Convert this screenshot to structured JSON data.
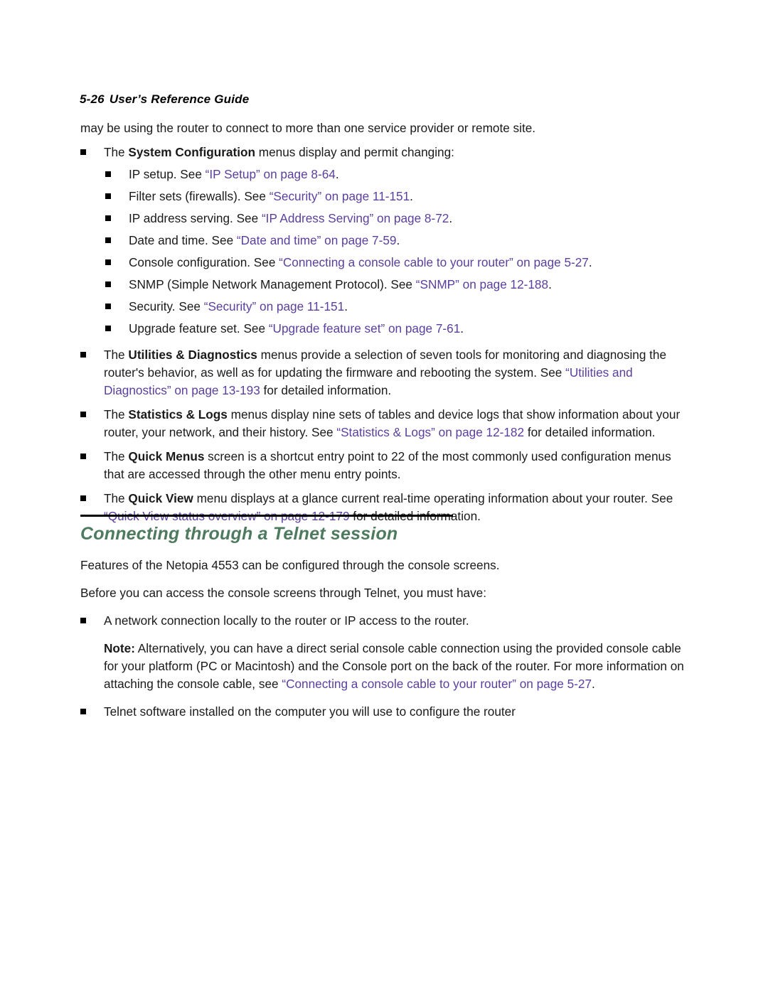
{
  "page": {
    "header": {
      "folio": "5-26",
      "title": "User’s Reference Guide"
    },
    "intro_paragraph": "may be using the router to connect to more than one service provider or remote site.",
    "bullets": [
      {
        "name": "system-configuration",
        "lead": "The ",
        "bold": "System Configuration",
        "tail": " menus display and permit changing:",
        "subitems": [
          {
            "name": "ip-setup",
            "lead": "IP setup. See ",
            "xref": "“IP Setup” on page 8-64",
            "tail": "."
          },
          {
            "name": "filter-sets",
            "lead": "Filter sets (firewalls). See ",
            "xref": "“Security” on page 11-151",
            "tail": "."
          },
          {
            "name": "ip-address-serving",
            "lead": "IP address serving. See ",
            "xref": "“IP Address Serving” on page 8-72",
            "tail": "."
          },
          {
            "name": "date-and-time",
            "lead": "Date and time. See ",
            "xref": "“Date and time” on page 7-59",
            "tail": "."
          },
          {
            "name": "console-configuration",
            "lead": "Console configuration. See ",
            "xref": "“Connecting a console cable to your router” on page 5-27",
            "tail": "."
          },
          {
            "name": "snmp",
            "lead": "SNMP (Simple Network Management Protocol). See ",
            "xref": "“SNMP” on page 12-188",
            "tail": "."
          },
          {
            "name": "security",
            "lead": "Security. See ",
            "xref": "“Security” on page 11-151",
            "tail": "."
          },
          {
            "name": "upgrade-feature-set",
            "lead": "Upgrade feature set. See ",
            "xref": "“Upgrade feature set” on page 7-61",
            "tail": "."
          }
        ]
      }
    ],
    "utilities_bullet": {
      "lead": "The ",
      "bold": "Utilities & Diagnostics",
      "mid": " menus provide a selection of seven tools for monitoring and diagnosing the router's behavior, as well as for updating the firmware and rebooting the system. See ",
      "xref": "“Utilities and Diagnostics” on page 13-193",
      "tail": " for detailed information."
    },
    "statistics_bullet": {
      "lead": "The ",
      "bold": "Statistics & Logs",
      "mid": " menus display nine sets of tables and device logs that show information about your router, your network, and their history. See ",
      "xref": "“Statistics & Logs” on page 12-182",
      "tail": " for detailed information."
    },
    "quick_menus_bullet": {
      "lead": "The ",
      "bold": "Quick Menus",
      "tail": " screen is a shortcut entry point to 22 of the most commonly used configuration menus that are accessed through the other menu entry points."
    },
    "quick_view_bullet": {
      "lead": "The ",
      "bold": "Quick View",
      "mid": " menu displays at a glance current real-time operating information about your router. See ",
      "xref": "“Quick View status overview” on page 12-179",
      "tail": " for detailed information."
    },
    "section": {
      "title": "Connecting through a Telnet session",
      "paragraph_1": "Features of the Netopia 4553 can be configured through the console screens.",
      "paragraph_2": "Before you can access the console screens through Telnet, you must have:",
      "bullet_network": "A network connection locally to the router or IP access to the router.",
      "note": {
        "label": "Note:",
        "lead": " Alternatively, you can have a direct serial console cable connection using the provided console cable for your platform (PC or Macintosh) and the Console port on the back of the router. For more information on attaching the console cable, see ",
        "xref": "“Connecting a console cable to your router” on page 5-27",
        "tail": "."
      },
      "bullet_telnet": "Telnet software installed on the computer you will use to configure the router"
    },
    "colors": {
      "xref": "#5b3f9d",
      "heading": "#4e7a5e",
      "body": "#1a1a1a",
      "rule": "#000000"
    }
  }
}
